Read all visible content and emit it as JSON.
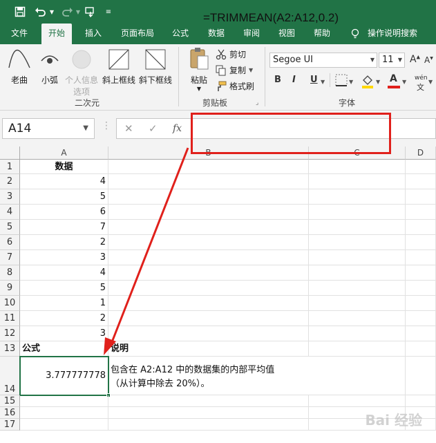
{
  "quick_access": {
    "save_icon": "save-icon",
    "undo_icon": "undo-icon",
    "redo_icon": "redo-icon",
    "touch_icon": "touch-mode-icon",
    "customize_icon": "customize-qa-icon"
  },
  "tabs": [
    {
      "label": "文件"
    },
    {
      "label": "开始"
    },
    {
      "label": "插入"
    },
    {
      "label": "页面布局"
    },
    {
      "label": "公式"
    },
    {
      "label": "数据"
    },
    {
      "label": "审阅"
    },
    {
      "label": "视图"
    },
    {
      "label": "帮助"
    },
    {
      "label": "操作说明搜索"
    }
  ],
  "ribbon": {
    "group_shapes": {
      "label": "二次元",
      "buttons": [
        {
          "label": "老曲"
        },
        {
          "label": "小弧"
        },
        {
          "label": "个人信息选项",
          "line1": "个人信息",
          "line2": "选项"
        },
        {
          "label": "斜上框线"
        },
        {
          "label": "斜下框线"
        }
      ]
    },
    "group_clipboard": {
      "label": "剪贴板",
      "paste": "粘贴",
      "cut": "剪切",
      "copy": "复制",
      "format_painter": "格式刷"
    },
    "group_font": {
      "label": "字体",
      "font_name": "Segoe UI",
      "font_size": "11",
      "grow": "A",
      "shrink": "A",
      "bold": "B",
      "italic": "I",
      "underline": "U",
      "font_color_letter": "A",
      "phonetic": "wén"
    }
  },
  "formula_bar": {
    "name_box": "A14",
    "cancel": "✕",
    "enter": "✓",
    "fx": "fx",
    "formula": "=TRIMMEAN(A2:A12,0.2)"
  },
  "columns": [
    {
      "label": "A"
    },
    {
      "label": "B"
    },
    {
      "label": "C"
    },
    {
      "label": "D"
    }
  ],
  "rows": [
    {
      "num": "1",
      "a": "数据",
      "b": ""
    },
    {
      "num": "2",
      "a": "4",
      "b": ""
    },
    {
      "num": "3",
      "a": "5",
      "b": ""
    },
    {
      "num": "4",
      "a": "6",
      "b": ""
    },
    {
      "num": "5",
      "a": "7",
      "b": ""
    },
    {
      "num": "6",
      "a": "2",
      "b": ""
    },
    {
      "num": "7",
      "a": "3",
      "b": ""
    },
    {
      "num": "8",
      "a": "4",
      "b": ""
    },
    {
      "num": "9",
      "a": "5",
      "b": ""
    },
    {
      "num": "10",
      "a": "1",
      "b": ""
    },
    {
      "num": "11",
      "a": "2",
      "b": ""
    },
    {
      "num": "12",
      "a": "3",
      "b": ""
    },
    {
      "num": "13",
      "a": "公式",
      "b": "说明"
    },
    {
      "num": "14",
      "a": "3.777777778",
      "b_line1": "包含在 A2:A12 中的数据集的内部平均值",
      "b_line2": "（从计算中除去 20%）。"
    },
    {
      "num": "15",
      "a": "",
      "b": ""
    },
    {
      "num": "16",
      "a": "",
      "b": ""
    },
    {
      "num": "17",
      "a": "",
      "b": ""
    }
  ],
  "watermark": "Bai 经验",
  "colors": {
    "excel_green": "#217346",
    "highlight_red": "#e0201b",
    "ribbon_bg": "#f3f3f3"
  }
}
